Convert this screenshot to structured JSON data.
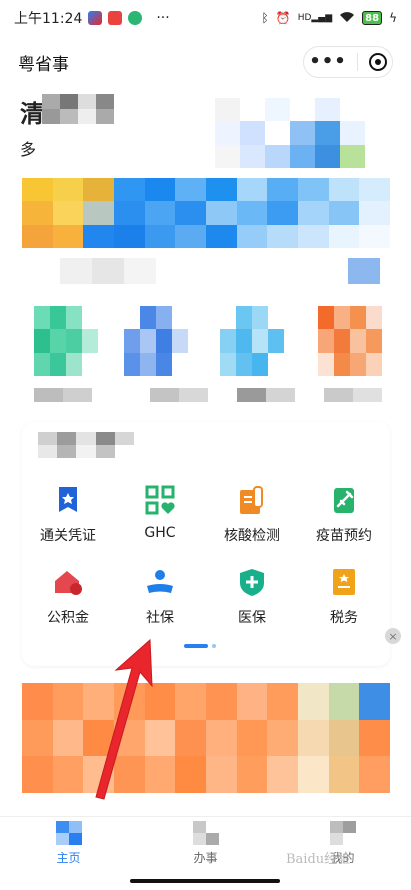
{
  "status_bar": {
    "time": "上午11:24",
    "more": "···",
    "battery": "88",
    "signal_label": "HD"
  },
  "nav": {
    "title": "粤省事",
    "more_glyph": "•••"
  },
  "header": {
    "greeting_char": "清",
    "sub_char": "多"
  },
  "services": [
    {
      "label": "通关凭证",
      "icon": "customs-pass-icon",
      "color": "#1f63d6"
    },
    {
      "label": "GHC",
      "icon": "ghc-qr-icon",
      "color": "#27b36b"
    },
    {
      "label": "核酸检测",
      "icon": "nucleic-test-icon",
      "color": "#f08a24"
    },
    {
      "label": "疫苗预约",
      "icon": "vaccine-icon",
      "color": "#27b36b"
    },
    {
      "label": "公积金",
      "icon": "housing-fund-icon",
      "color": "#e5474e"
    },
    {
      "label": "社保",
      "icon": "social-security-icon",
      "color": "#1f7ee8"
    },
    {
      "label": "医保",
      "icon": "medical-insurance-icon",
      "color": "#18b08a"
    },
    {
      "label": "税务",
      "icon": "tax-icon",
      "color": "#f0a318"
    }
  ],
  "banner_close": "×",
  "tabs": [
    {
      "label": "主页",
      "active": true
    },
    {
      "label": "办事",
      "active": false
    },
    {
      "label": "我的",
      "active": false
    }
  ],
  "watermark": "Baidu经验",
  "colors": {
    "accent": "#2a7ff0",
    "arrow": "#e8262c"
  }
}
